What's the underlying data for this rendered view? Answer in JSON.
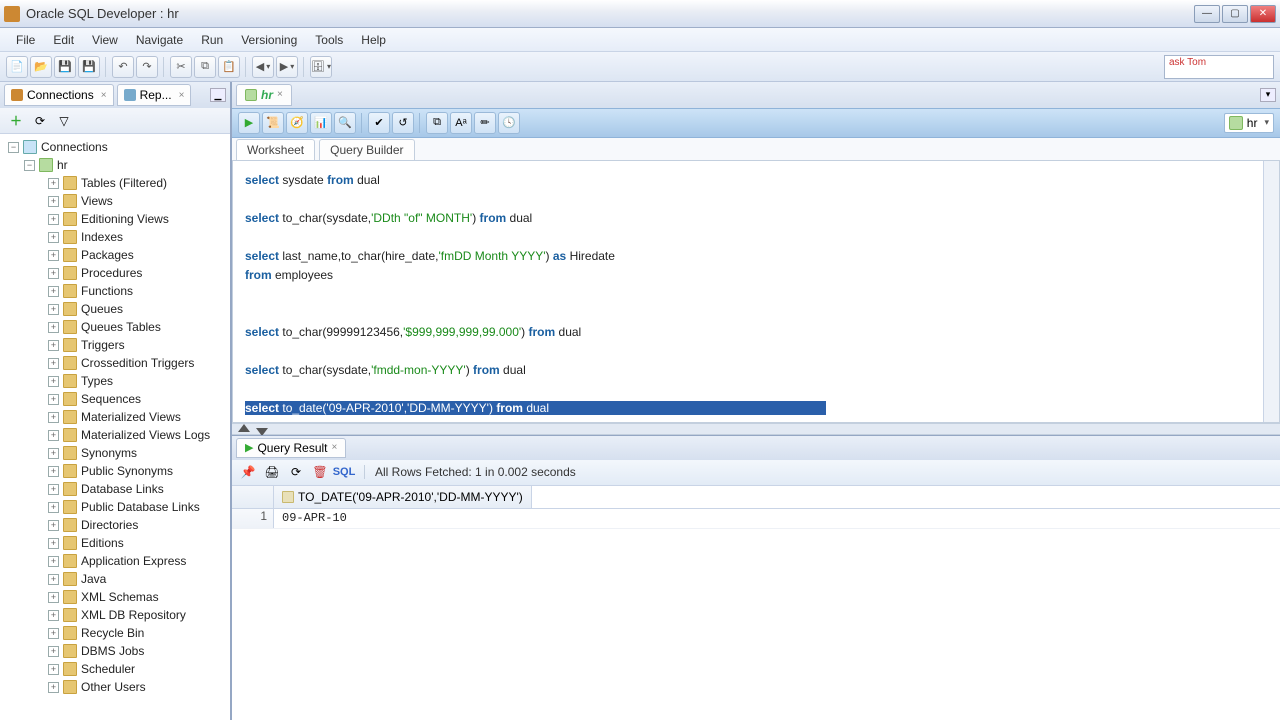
{
  "window": {
    "title": "Oracle SQL Developer : hr"
  },
  "menu": [
    "File",
    "Edit",
    "View",
    "Navigate",
    "Run",
    "Versioning",
    "Tools",
    "Help"
  ],
  "asktom": "ask\nTom",
  "left_tabs": [
    {
      "label": "Connections",
      "closable": true
    },
    {
      "label": "Rep...",
      "closable": true
    }
  ],
  "connections_root": "Connections",
  "active_conn": "hr",
  "tree": [
    "Tables (Filtered)",
    "Views",
    "Editioning Views",
    "Indexes",
    "Packages",
    "Procedures",
    "Functions",
    "Queues",
    "Queues Tables",
    "Triggers",
    "Crossedition Triggers",
    "Types",
    "Sequences",
    "Materialized Views",
    "Materialized Views Logs",
    "Synonyms",
    "Public Synonyms",
    "Database Links",
    "Public Database Links",
    "Directories",
    "Editions",
    "Application Express",
    "Java",
    "XML Schemas",
    "XML DB Repository",
    "Recycle Bin",
    "DBMS Jobs",
    "Scheduler",
    "Other Users"
  ],
  "editor_tab": "hr",
  "conn_selector": "hr",
  "worksheet_tabs": [
    "Worksheet",
    "Query Builder"
  ],
  "sql": {
    "l1a": "select",
    "l1b": " sysdate ",
    "l1c": "from",
    "l1d": " dual",
    "l2a": "select",
    "l2b": " to_char(sysdate,",
    "l2s": "'DDth \"of\" MONTH'",
    "l2c": ") ",
    "l2d": "from",
    "l2e": " dual",
    "l3a": "select",
    "l3b": " last_name,to_char(hire_date,",
    "l3s": "'fmDD Month YYYY'",
    "l3c": ") ",
    "l3d": "as",
    "l3e": " Hiredate",
    "l3f": "from",
    "l3g": " employees",
    "l4a": "select",
    "l4b": " to_char(99999123456,",
    "l4s": "'$999,999,999,99.000'",
    "l4c": ") ",
    "l4d": "from",
    "l4e": " dual",
    "l5a": "select",
    "l5b": " to_char(sysdate,",
    "l5s": "'fmdd-mon-YYYY'",
    "l5c": ") ",
    "l5d": "from",
    "l5e": " dual",
    "l6a": "select",
    "l6b": " to_date(",
    "l6s1": "'09-APR-2010'",
    "l6m": ",",
    "l6s2": "'DD-MM-YYYY'",
    "l6c": ") ",
    "l6d": "from",
    "l6e": " dual"
  },
  "result_tab": "Query Result",
  "sql_badge": "SQL",
  "status": "All Rows Fetched: 1 in 0.002 seconds",
  "grid": {
    "col": "TO_DATE('09-APR-2010','DD-MM-YYYY')",
    "rownum": "1",
    "value": "09-APR-10"
  }
}
